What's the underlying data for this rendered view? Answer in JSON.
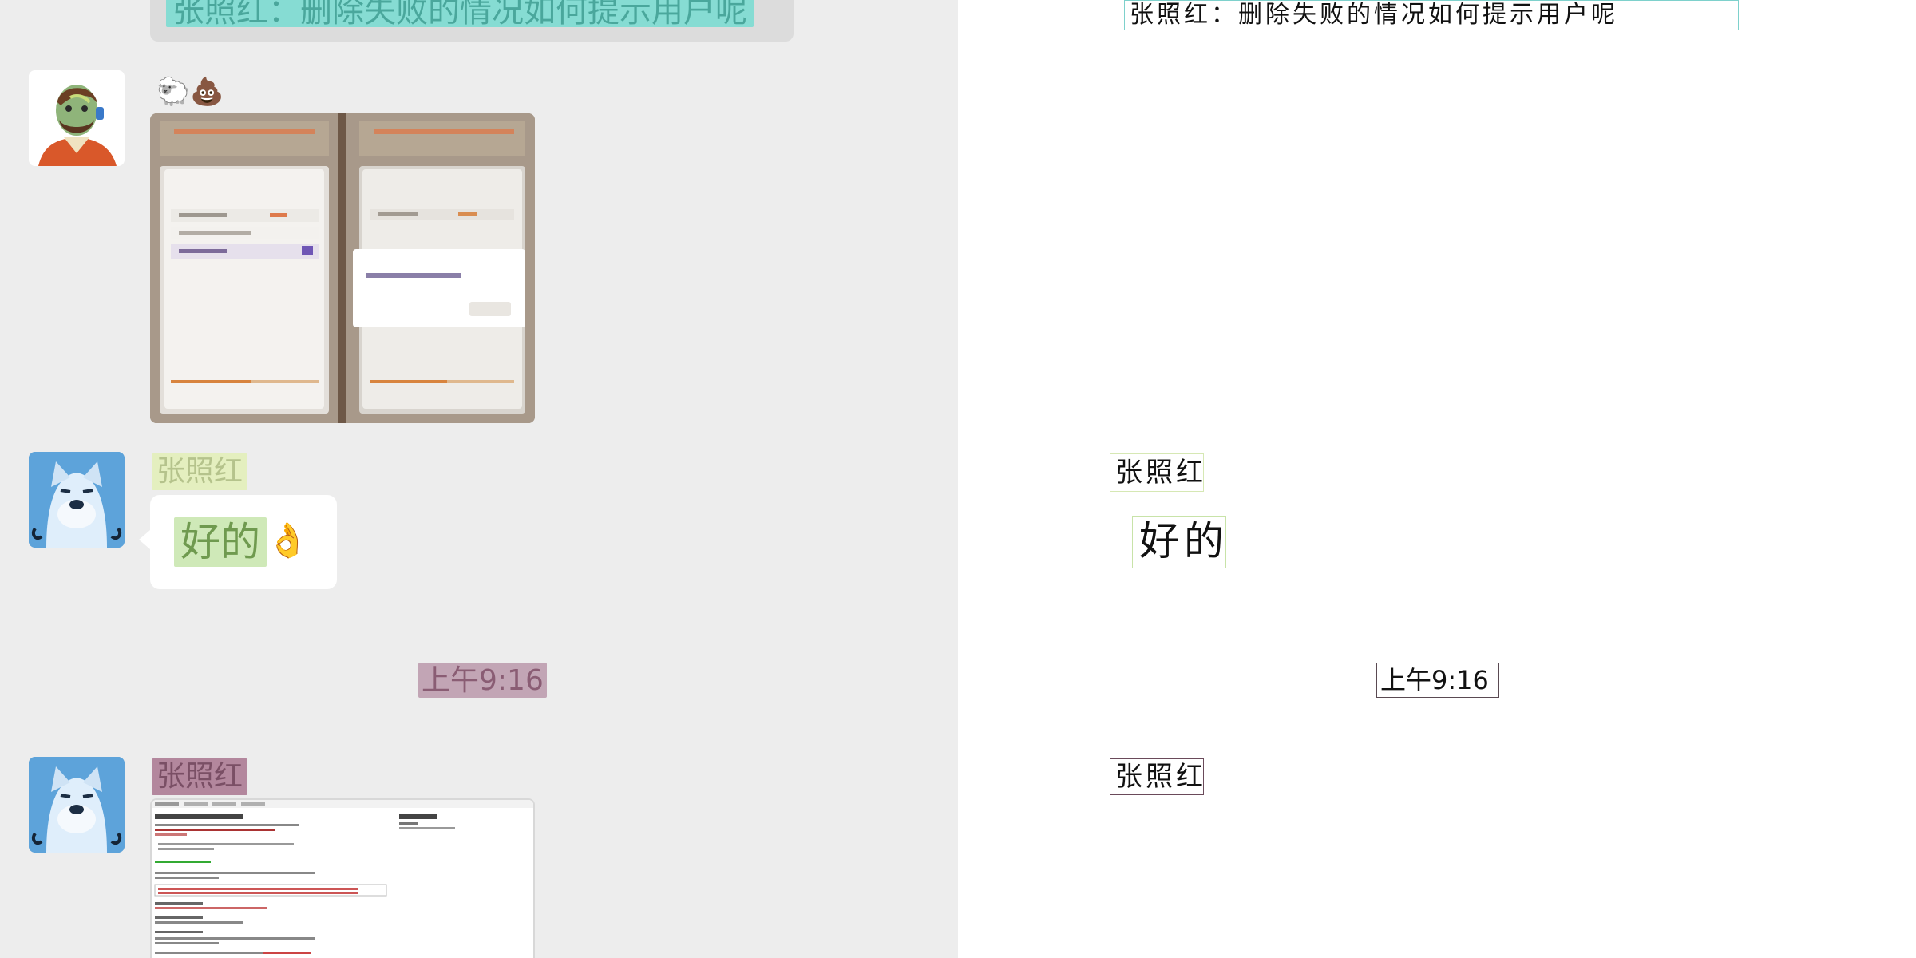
{
  "messages": {
    "top_text": "张照红：删除失败的情况如何提示用户呢",
    "emoji_text": "🐑💩",
    "sender_name_1": "张照红",
    "reply_text": "好的",
    "reply_emoji": "👌",
    "timestamp": "上午9:16",
    "sender_name_2": "张照红"
  },
  "annotations": {
    "top_text": "张照红：删除失败的情况如何提示用户呢",
    "name_1": "张照红",
    "reply_text": "好的",
    "timestamp": "上午9:16",
    "name_2": "张照红"
  },
  "colors": {
    "chat_background": "#ededed",
    "highlight_cyan": "#86dcd3",
    "highlight_green": "#cfe9b8",
    "highlight_mauve": "#c2a5b5",
    "name_green": "#e4efbf"
  }
}
